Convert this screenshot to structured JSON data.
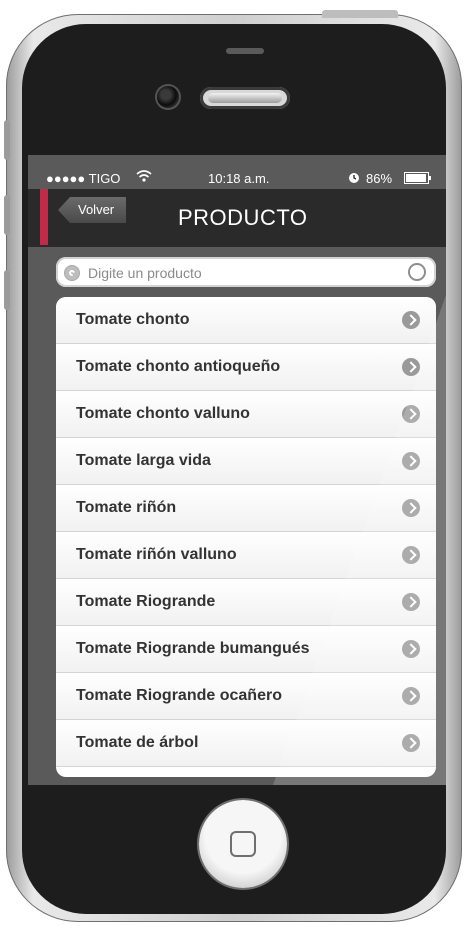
{
  "colors": {
    "accent": "#c02b4a"
  },
  "status": {
    "carrier": "●●●●● TIGO",
    "wifi_icon": "wifi-icon",
    "time": "10:18 a.m.",
    "alarm_icon": "alarm-icon",
    "battery": "86%",
    "battery_icon": "battery-icon"
  },
  "nav": {
    "back_label": "Volver",
    "title": "PRODUCTO"
  },
  "search": {
    "placeholder": "Digite un producto",
    "value": ""
  },
  "list": {
    "items": [
      {
        "label": "Tomate chonto"
      },
      {
        "label": "Tomate chonto antioqueño"
      },
      {
        "label": "Tomate chonto valluno"
      },
      {
        "label": "Tomate larga vida"
      },
      {
        "label": "Tomate riñón"
      },
      {
        "label": "Tomate riñón valluno"
      },
      {
        "label": "Tomate Riogrande"
      },
      {
        "label": "Tomate Riogrande bumangués"
      },
      {
        "label": "Tomate Riogrande ocañero"
      },
      {
        "label": "Tomate de árbol"
      }
    ]
  }
}
